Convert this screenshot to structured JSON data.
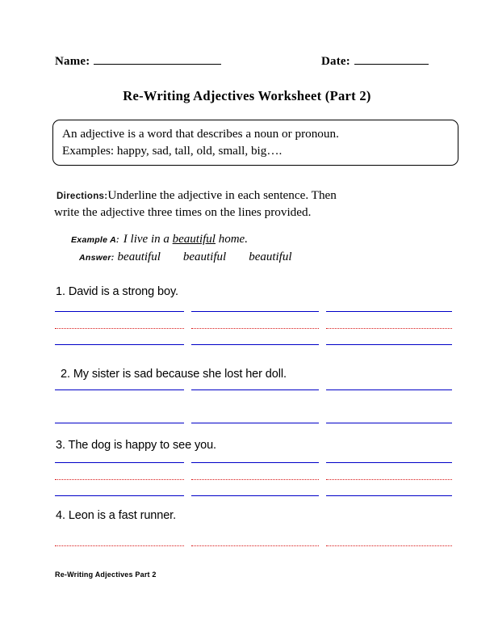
{
  "header": {
    "name_label": "Name:",
    "date_label": "Date:",
    "title": "Re-Writing Adjectives Worksheet (Part 2)"
  },
  "definition_box": {
    "line1": "An adjective is a word that describes a noun or pronoun.",
    "line2": "Examples: happy, sad, tall, old, small, big…."
  },
  "directions": {
    "label": "Directions:",
    "line1": "Underline the adjective in each sentence. Then",
    "line2": "write the adjective three times on the lines provided."
  },
  "example": {
    "label": "Example A:",
    "text_before": "I live in a ",
    "adjective": "beautiful",
    "text_after": " home.",
    "answer_label": "Answer:",
    "answers": [
      "beautiful",
      "beautiful",
      "beautiful"
    ]
  },
  "questions": [
    {
      "text": "1. David is a strong boy.",
      "rules": [
        "top",
        "mid",
        "bot"
      ]
    },
    {
      "text": "2. My sister is sad because she lost her doll.",
      "rules": [
        "top",
        "bot"
      ]
    },
    {
      "text": "3. The dog is happy to see you.",
      "rules": [
        "top",
        "mid",
        "bot"
      ]
    },
    {
      "text": "4. Leon is a fast runner.",
      "rules": [
        "mid"
      ]
    }
  ],
  "footer": {
    "text": "Re-Writing Adjectives Part 2"
  },
  "colors": {
    "rule_blue": "#0000c8",
    "rule_red": "#d81818",
    "text": "#000000",
    "background": "#ffffff"
  }
}
